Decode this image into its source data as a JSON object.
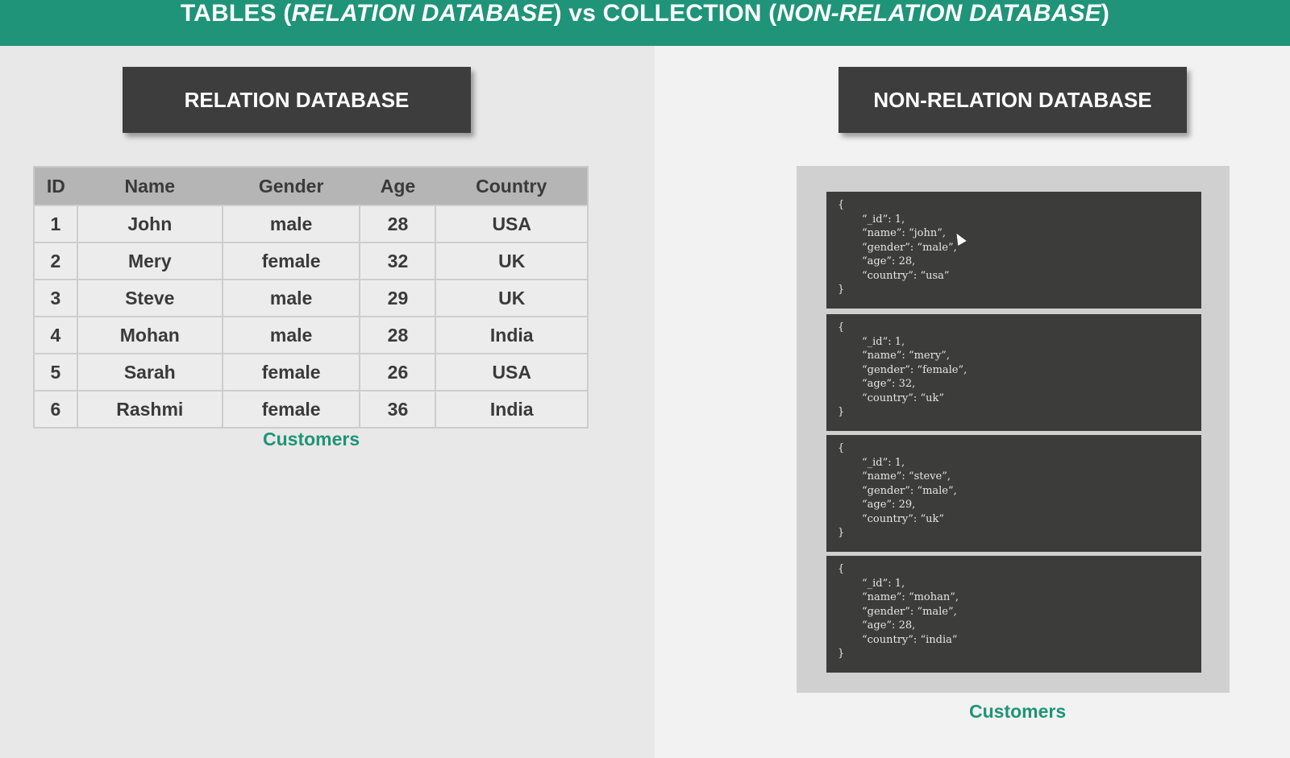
{
  "banner": {
    "part1": "TABLES (",
    "part2": "RELATION DATABASE",
    "part3": ") vs COLLECTION (",
    "part4": "NON-RELATION DATABASE",
    "part5": ")"
  },
  "left": {
    "heading": "RELATION DATABASE",
    "table": {
      "headers": [
        "ID",
        "Name",
        "Gender",
        "Age",
        "Country"
      ],
      "rows": [
        [
          "1",
          "John",
          "male",
          "28",
          "USA"
        ],
        [
          "2",
          "Mery",
          "female",
          "32",
          "UK"
        ],
        [
          "3",
          "Steve",
          "male",
          "29",
          "UK"
        ],
        [
          "4",
          "Mohan",
          "male",
          "28",
          "India"
        ],
        [
          "5",
          "Sarah",
          "female",
          "26",
          "USA"
        ],
        [
          "6",
          "Rashmi",
          "female",
          "36",
          "India"
        ]
      ]
    },
    "caption": "Customers"
  },
  "right": {
    "heading": "NON-RELATION DATABASE",
    "documents": [
      {
        "open": "{",
        "lines": [
          "“_id”: 1,",
          "“name”: “john”,",
          "“gender”: “male”,",
          "“age”: 28,",
          "“country”: “usa”"
        ],
        "close": "}"
      },
      {
        "open": "{",
        "lines": [
          "“_id”: 1,",
          "“name”: “mery”,",
          "“gender”: “female”,",
          "“age”: 32,",
          "“country”: “uk”"
        ],
        "close": "}"
      },
      {
        "open": "{",
        "lines": [
          "“_id”: 1,",
          "“name”: “steve”,",
          "“gender”: “male”,",
          "“age”: 29,",
          "“country”: “uk”"
        ],
        "close": "}"
      },
      {
        "open": "{",
        "lines": [
          "“_id”: 1,",
          "“name”: “mohan”,",
          "“gender”: “male”,",
          "“age”: 28,",
          "“country”: “india”"
        ],
        "close": "}"
      }
    ],
    "caption": "Customers"
  },
  "colors": {
    "banner": "#1f9478",
    "heading_box": "#3c3d3c",
    "caption": "#1f9478",
    "document_bg": "#3c3c3b"
  },
  "icons": [
    "mouse-cursor-icon"
  ]
}
